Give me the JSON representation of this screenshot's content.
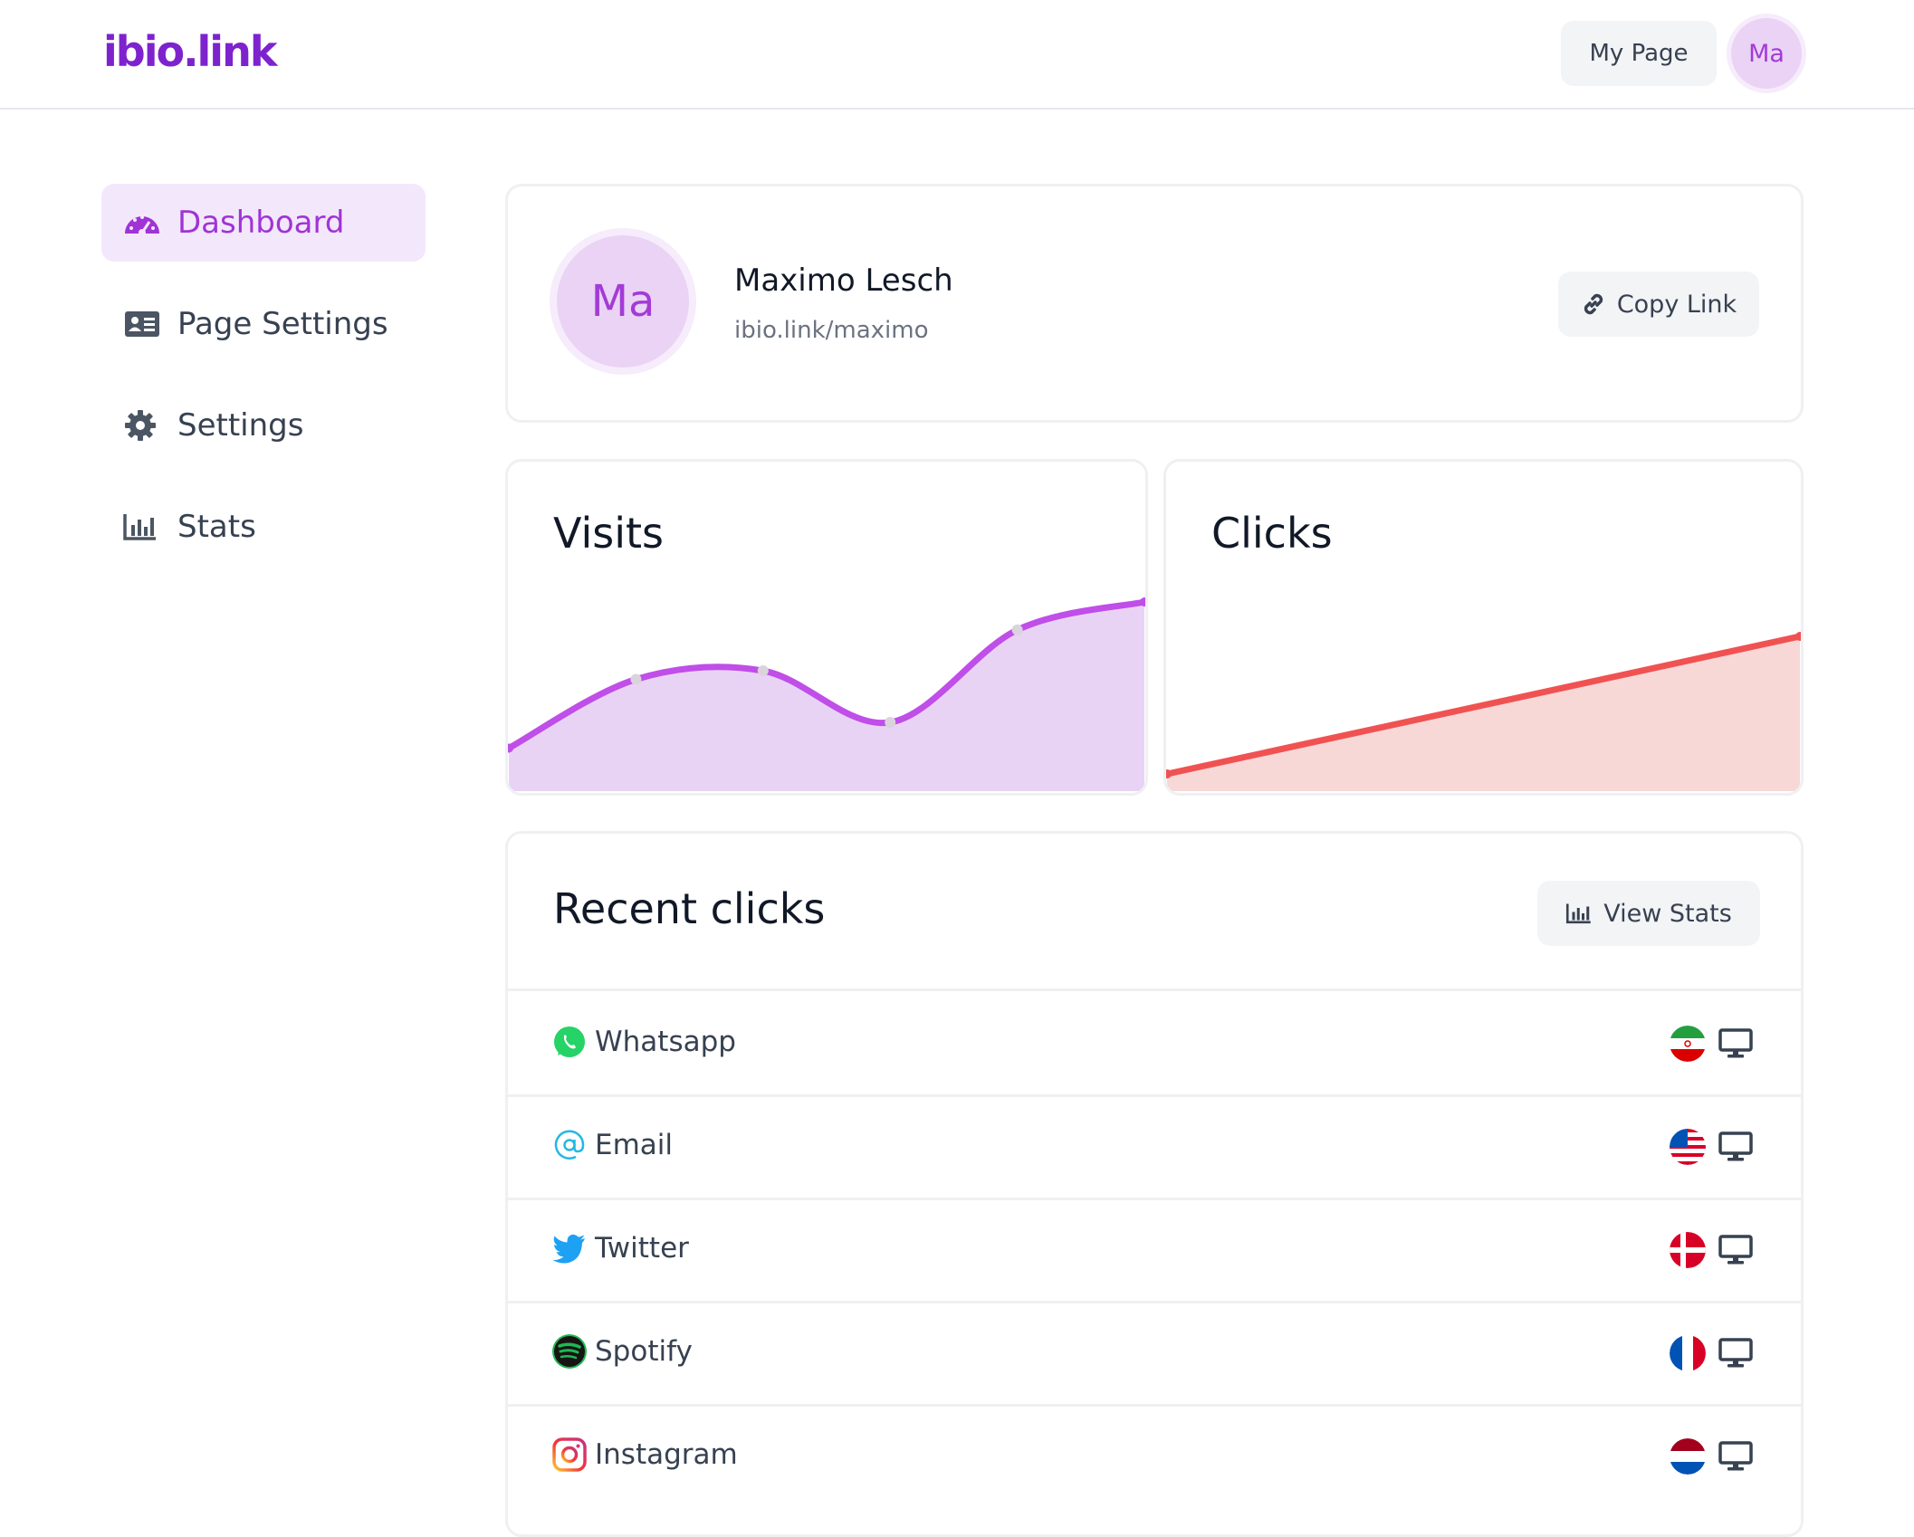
{
  "header": {
    "logo": "ibio.link",
    "my_page": "My Page",
    "avatar_initials": "Ma"
  },
  "sidebar": {
    "items": [
      {
        "label": "Dashboard",
        "icon": "gauge-icon",
        "active": true
      },
      {
        "label": "Page Settings",
        "icon": "id-card-icon",
        "active": false
      },
      {
        "label": "Settings",
        "icon": "gear-icon",
        "active": false
      },
      {
        "label": "Stats",
        "icon": "bar-chart-icon",
        "active": false
      }
    ]
  },
  "profile": {
    "initials": "Ma",
    "name": "Maximo Lesch",
    "url": "ibio.link/maximo",
    "copy_link": "Copy Link"
  },
  "charts": {
    "visits_title": "Visits",
    "clicks_title": "Clicks"
  },
  "chart_data": [
    {
      "type": "area",
      "title": "Visits",
      "color": "#c04ee8",
      "fill": "#e8d3f5",
      "values": [
        2,
        5.2,
        5.6,
        3.2,
        7.5,
        8.8
      ],
      "ylim": [
        0,
        16
      ]
    },
    {
      "type": "area",
      "title": "Clicks",
      "color": "#f05252",
      "fill": "#f8d7d7",
      "values": [
        1,
        9
      ],
      "ylim": [
        0,
        20
      ]
    }
  ],
  "recent": {
    "title": "Recent clicks",
    "view_stats": "View Stats",
    "rows": [
      {
        "label": "Whatsapp",
        "icon": "whatsapp-icon",
        "flag": "iran-flag-icon",
        "device": "desktop-icon"
      },
      {
        "label": "Email",
        "icon": "at-sign-icon",
        "flag": "usa-flag-icon",
        "device": "desktop-icon"
      },
      {
        "label": "Twitter",
        "icon": "twitter-icon",
        "flag": "denmark-flag-icon",
        "device": "desktop-icon"
      },
      {
        "label": "Spotify",
        "icon": "spotify-icon",
        "flag": "france-flag-icon",
        "device": "desktop-icon"
      },
      {
        "label": "Instagram",
        "icon": "instagram-icon",
        "flag": "netherlands-flag-icon",
        "device": "desktop-icon"
      }
    ]
  },
  "colors": {
    "brand": "#7e22ce",
    "accent": "#a033d6"
  }
}
